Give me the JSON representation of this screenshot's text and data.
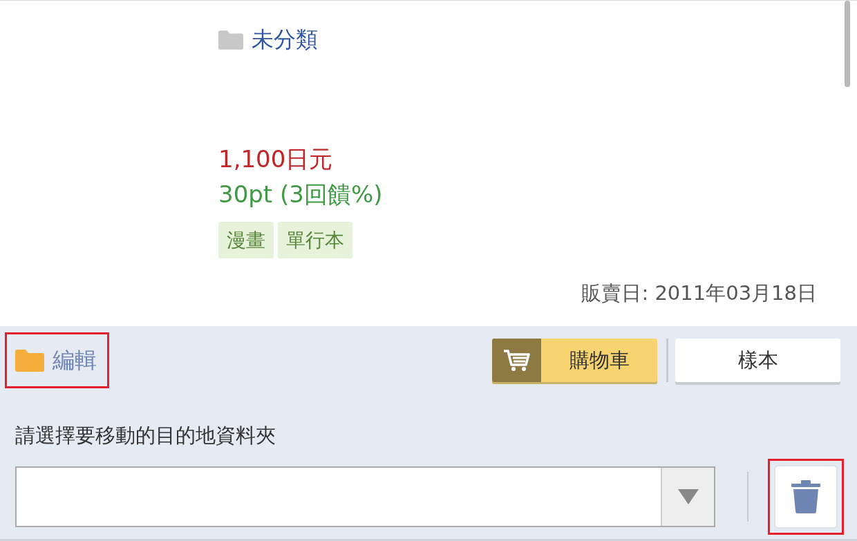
{
  "category": {
    "label": "未分類"
  },
  "price": "1,100日元",
  "points": "30pt (3回饋%)",
  "tags": [
    "漫畫",
    "單行本"
  ],
  "release_date": "販賣日: 2011年03月18日",
  "actions": {
    "edit": {
      "label": "編輯",
      "highlighted": true
    },
    "cart_button": {
      "label": "購物車"
    },
    "sample_button": {
      "label": "樣本"
    }
  },
  "move_folder": {
    "label": "請選擇要移動的目的地資料夾",
    "delete_highlighted": true
  }
}
